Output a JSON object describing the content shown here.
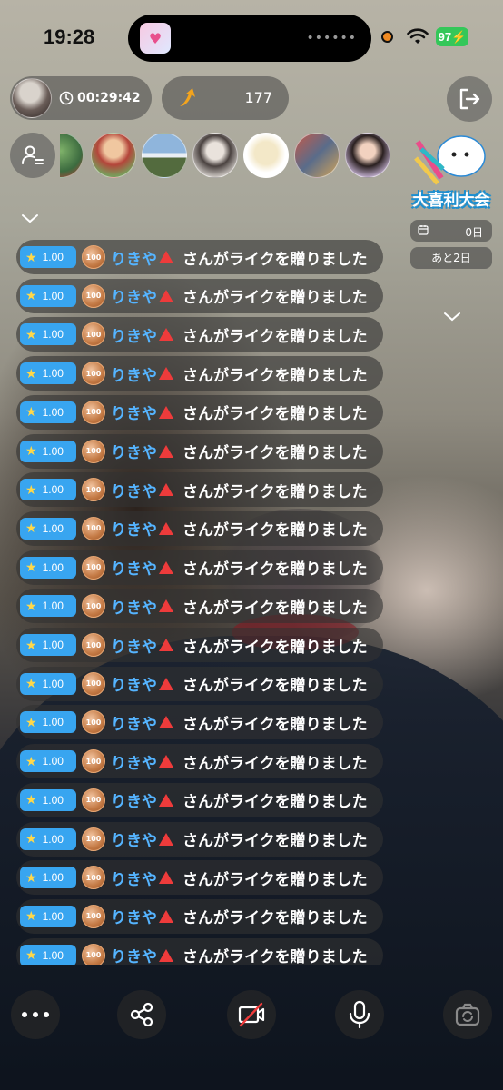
{
  "status_bar": {
    "time": "19:28",
    "battery": "97",
    "island_app_icon": "heart-app-icon",
    "island_dots": "••••••"
  },
  "header": {
    "timer": "00:29:42",
    "score": "177"
  },
  "event": {
    "title": "大喜利大会",
    "count": "0日",
    "days_left": "あと2日"
  },
  "chat": {
    "messages": [
      {
        "level": "1.00",
        "medal": "100",
        "user": "りきや",
        "text": "さんがライクを贈りました"
      },
      {
        "level": "1.00",
        "medal": "100",
        "user": "りきや",
        "text": "さんがライクを贈りました"
      },
      {
        "level": "1.00",
        "medal": "100",
        "user": "りきや",
        "text": "さんがライクを贈りました"
      },
      {
        "level": "1.00",
        "medal": "100",
        "user": "りきや",
        "text": "さんがライクを贈りました"
      },
      {
        "level": "1.00",
        "medal": "100",
        "user": "りきや",
        "text": "さんがライクを贈りました"
      },
      {
        "level": "1.00",
        "medal": "100",
        "user": "りきや",
        "text": "さんがライクを贈りました"
      },
      {
        "level": "1.00",
        "medal": "100",
        "user": "りきや",
        "text": "さんがライクを贈りました"
      },
      {
        "level": "1.00",
        "medal": "100",
        "user": "りきや",
        "text": "さんがライクを贈りました"
      },
      {
        "level": "1.00",
        "medal": "100",
        "user": "りきや",
        "text": "さんがライクを贈りました"
      },
      {
        "level": "1.00",
        "medal": "100",
        "user": "りきや",
        "text": "さんがライクを贈りました"
      },
      {
        "level": "1.00",
        "medal": "100",
        "user": "りきや",
        "text": "さんがライクを贈りました"
      },
      {
        "level": "1.00",
        "medal": "100",
        "user": "りきや",
        "text": "さんがライクを贈りました"
      },
      {
        "level": "1.00",
        "medal": "100",
        "user": "りきや",
        "text": "さんがライクを贈りました"
      },
      {
        "level": "1.00",
        "medal": "100",
        "user": "りきや",
        "text": "さんがライクを贈りました"
      },
      {
        "level": "1.00",
        "medal": "100",
        "user": "りきや",
        "text": "さんがライクを贈りました"
      },
      {
        "level": "1.00",
        "medal": "100",
        "user": "りきや",
        "text": "さんがライクを贈りました"
      },
      {
        "level": "1.00",
        "medal": "100",
        "user": "りきや",
        "text": "さんがライクを贈りました"
      },
      {
        "level": "1.00",
        "medal": "100",
        "user": "りきや",
        "text": "さんがライクを贈りました"
      },
      {
        "level": "1.00",
        "medal": "100",
        "user": "りきや",
        "text": "さんがライクを贈りました"
      }
    ]
  },
  "bottom_bar": {
    "buttons": [
      "more-icon",
      "share-icon",
      "camera-off-icon",
      "microphone-icon",
      "flip-camera-icon"
    ]
  },
  "colors": {
    "accent": "#38a5f0",
    "username": "#55b4ff",
    "battery": "#34c759",
    "recording": "#f08a22"
  }
}
